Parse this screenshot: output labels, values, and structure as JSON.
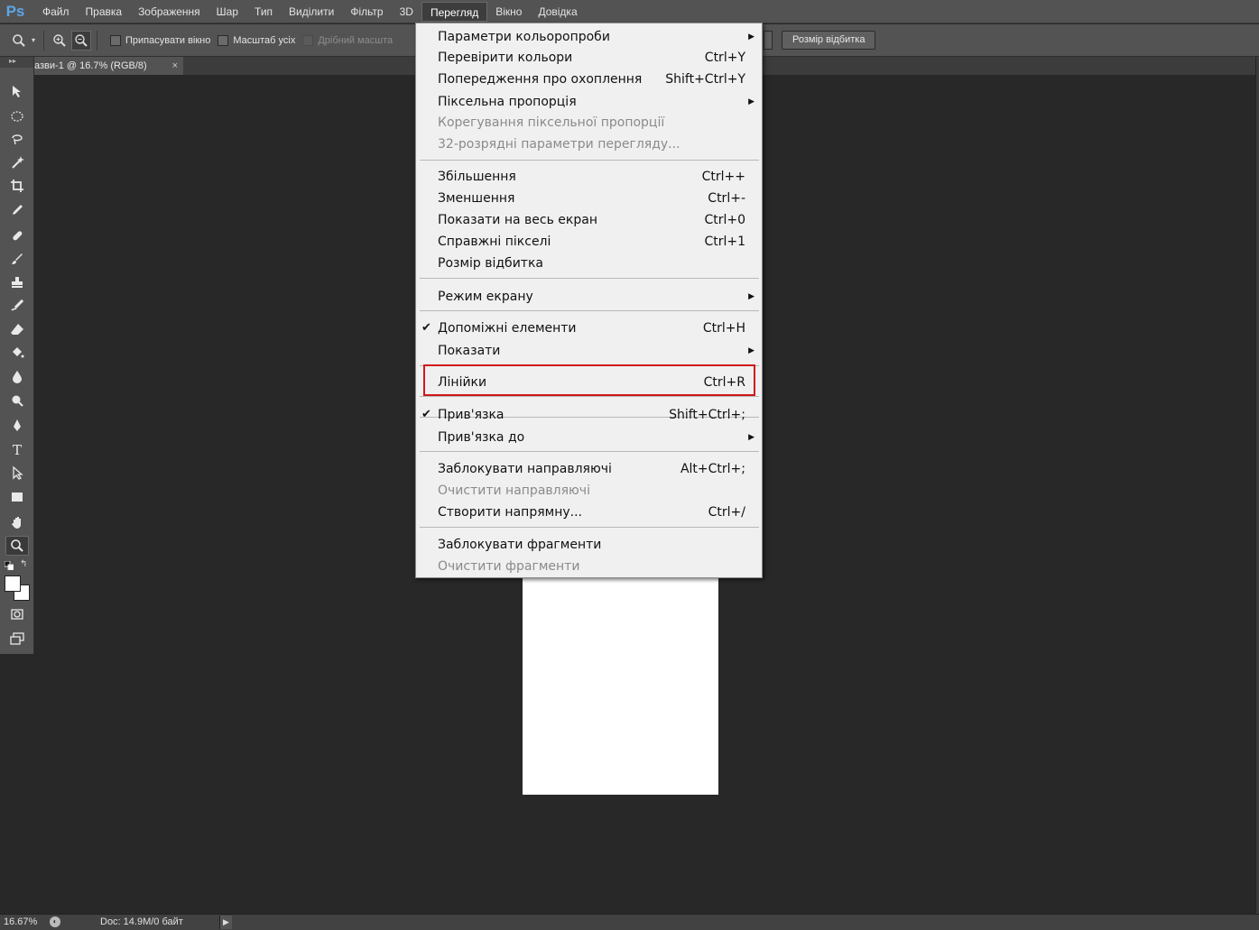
{
  "app": {
    "logo": "Ps",
    "menubar": [
      "Файл",
      "Правка",
      "Зображення",
      "Шар",
      "Тип",
      "Виділити",
      "Фільтр",
      "3D",
      "Перегляд",
      "Вікно",
      "Довідка"
    ]
  },
  "options": {
    "fit_window": "Припасувати вікно",
    "zoom_all": "Масштаб усіх",
    "scrubby": "Дрібний масшта",
    "print_size_button": "Розмір відбитка"
  },
  "document": {
    "tab_title": "азви-1 @ 16.7% (RGB/8)",
    "tab_close": "×"
  },
  "status": {
    "zoom": "16.67%",
    "doc_info": "Doc: 14.9M/0 байт"
  },
  "view_menu": {
    "items": [
      {
        "label": "Параметри кольоропроби",
        "shortcut": "",
        "submenu": true
      },
      {
        "label": "Перевірити кольори",
        "shortcut": "Ctrl+Y"
      },
      {
        "label": "Попередження про охоплення",
        "shortcut": "Shift+Ctrl+Y"
      },
      {
        "label": "Піксельна пропорція",
        "shortcut": "",
        "submenu": true
      },
      {
        "label": "Корегування піксельної пропорції",
        "shortcut": "",
        "disabled": true
      },
      {
        "label": "32-розрядні параметри перегляду...",
        "shortcut": "",
        "disabled": true
      },
      {
        "label": "Збільшення",
        "shortcut": "Ctrl++"
      },
      {
        "label": "Зменшення",
        "shortcut": "Ctrl+-"
      },
      {
        "label": "Показати на весь екран",
        "shortcut": "Ctrl+0"
      },
      {
        "label": "Справжні пікселі",
        "shortcut": "Ctrl+1"
      },
      {
        "label": "Розмір відбитка",
        "shortcut": ""
      },
      {
        "label": "Режим екрану",
        "shortcut": "",
        "submenu": true
      },
      {
        "label": "Допоміжні елементи",
        "shortcut": "Ctrl+H",
        "checked": true
      },
      {
        "label": "Показати",
        "shortcut": "",
        "submenu": true
      },
      {
        "label": "Лінійки",
        "shortcut": "Ctrl+R",
        "highlighted": true
      },
      {
        "label": "Прив'язка",
        "shortcut": "Shift+Ctrl+;",
        "checked": true
      },
      {
        "label": "Прив'язка до",
        "shortcut": "",
        "submenu": true
      },
      {
        "label": "Заблокувати направляючі",
        "shortcut": "Alt+Ctrl+;"
      },
      {
        "label": "Очистити направляючі",
        "shortcut": "",
        "disabled": true
      },
      {
        "label": "Створити напрямну...",
        "shortcut": "Ctrl+/"
      },
      {
        "label": "Заблокувати фрагменти",
        "shortcut": ""
      },
      {
        "label": "Очистити фрагменти",
        "shortcut": "",
        "disabled": true
      }
    ]
  },
  "colors": {
    "highlight_border": "#d01818",
    "logo": "#5aa7e8"
  }
}
